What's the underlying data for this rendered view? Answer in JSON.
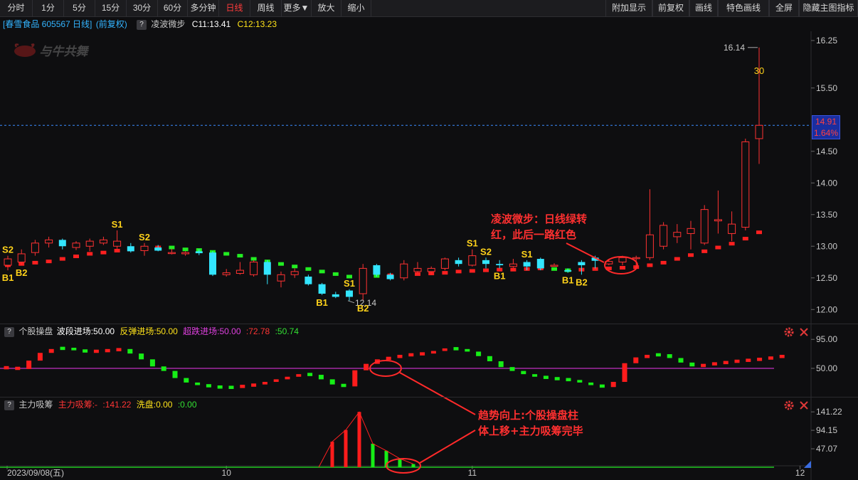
{
  "toolbar": {
    "left": [
      {
        "label": "分时",
        "name": "tab-intraday",
        "w": 46,
        "active": false
      },
      {
        "label": "1分",
        "name": "tab-1min",
        "w": 44,
        "active": false
      },
      {
        "label": "5分",
        "name": "tab-5min",
        "w": 44,
        "active": false
      },
      {
        "label": "15分",
        "name": "tab-15min",
        "w": 44,
        "active": false
      },
      {
        "label": "30分",
        "name": "tab-30min",
        "w": 44,
        "active": false
      },
      {
        "label": "60分",
        "name": "tab-60min",
        "w": 42,
        "active": false
      },
      {
        "label": "多分钟",
        "name": "tab-multi-minute",
        "w": 44,
        "active": false
      },
      {
        "label": "日线",
        "name": "tab-daily",
        "w": 44,
        "active": true
      },
      {
        "label": "周线",
        "name": "tab-weekly",
        "w": 44,
        "active": false
      },
      {
        "label": "更多▼",
        "name": "tab-more",
        "w": 42,
        "active": false
      },
      {
        "label": "放大",
        "name": "zoom-in-button",
        "w": 42,
        "active": false
      },
      {
        "label": "缩小",
        "name": "zoom-out-button",
        "w": 42,
        "active": false
      }
    ],
    "right": [
      {
        "label": "附加显示",
        "name": "extra-display-button",
        "w": 66
      },
      {
        "label": "前复权",
        "name": "forward-adjust-button",
        "w": 52
      },
      {
        "label": "画线",
        "name": "draw-line-button",
        "w": 40
      },
      {
        "label": "特色画线",
        "name": "feature-draw-button",
        "w": 72
      },
      {
        "label": "全屏",
        "name": "fullscreen-button",
        "w": 42
      },
      {
        "label": "隐藏主图指标",
        "name": "hide-indicators-button",
        "w": 83
      }
    ]
  },
  "info": {
    "stock": "[春雪食品 605567 日线]",
    "adjust": "(前复权)",
    "question": "?",
    "indicator": "凌波微步",
    "c1": "C11:13.41",
    "c2": "C12:13.23"
  },
  "logo": "与牛共舞",
  "main_chart": {
    "y_ticks": [
      "16.25",
      "15.50",
      "14.50",
      "14.00",
      "13.50",
      "13.00",
      "12.50",
      "12.00"
    ],
    "current_price": "14.91",
    "change_pct": "1.64%",
    "high_label": "16.14",
    "low_label": "12.14",
    "limit_label": "30",
    "colors": {
      "up": "#ff3232",
      "down": "#33e5ff",
      "line_up": "#ff2020",
      "line_down": "#22ee22",
      "signal": "#ffd21a",
      "price_line": "#3a8cff"
    },
    "signals": [
      {
        "text": "S2",
        "ix": 0,
        "pos": "above"
      },
      {
        "text": "B1",
        "ix": 0,
        "pos": "below"
      },
      {
        "text": "B2",
        "ix": 1,
        "pos": "below"
      },
      {
        "text": "S1",
        "ix": 8,
        "pos": "above"
      },
      {
        "text": "S2",
        "ix": 10,
        "pos": "above"
      },
      {
        "text": "B1",
        "ix": 23,
        "pos": "below"
      },
      {
        "text": "S1",
        "ix": 25,
        "pos": "above"
      },
      {
        "text": "B2",
        "ix": 26,
        "pos": "below"
      },
      {
        "text": "S1",
        "ix": 34,
        "pos": "above"
      },
      {
        "text": "S2",
        "ix": 35,
        "pos": "above"
      },
      {
        "text": "B1",
        "ix": 36,
        "pos": "below"
      },
      {
        "text": "S1",
        "ix": 38,
        "pos": "above"
      },
      {
        "text": "B1",
        "ix": 41,
        "pos": "below"
      },
      {
        "text": "B2",
        "ix": 42,
        "pos": "below"
      }
    ]
  },
  "chart_data": {
    "type": "candlestick",
    "ylim": [
      11.95,
      16.35
    ],
    "candles": [
      [
        12.7,
        12.8,
        12.62,
        12.85
      ],
      [
        12.75,
        12.88,
        12.7,
        12.95
      ],
      [
        12.9,
        13.05,
        12.85,
        13.1
      ],
      [
        13.05,
        13.1,
        12.98,
        13.15
      ],
      [
        13.1,
        13.0,
        12.95,
        13.12
      ],
      [
        12.98,
        13.05,
        12.94,
        13.08
      ],
      [
        13.0,
        13.08,
        12.92,
        13.12
      ],
      [
        13.05,
        13.1,
        13.02,
        13.15
      ],
      [
        13.0,
        13.08,
        12.96,
        13.25
      ],
      [
        13.0,
        12.92,
        12.9,
        13.05
      ],
      [
        12.93,
        13.0,
        12.85,
        13.05
      ],
      [
        12.98,
        12.93,
        12.92,
        13.02
      ],
      [
        12.9,
        12.9,
        12.87,
        12.96
      ],
      [
        12.88,
        12.9,
        12.85,
        12.92
      ],
      [
        12.92,
        12.89,
        12.86,
        12.95
      ],
      [
        12.9,
        12.55,
        12.53,
        12.92
      ],
      [
        12.55,
        12.58,
        12.52,
        12.64
      ],
      [
        12.57,
        12.62,
        12.55,
        12.75
      ],
      [
        12.55,
        12.75,
        12.52,
        12.78
      ],
      [
        12.75,
        12.55,
        12.4,
        12.78
      ],
      [
        12.45,
        12.55,
        12.35,
        12.6
      ],
      [
        12.55,
        12.6,
        12.5,
        12.65
      ],
      [
        12.52,
        12.4,
        12.38,
        12.55
      ],
      [
        12.4,
        12.25,
        12.23,
        12.42
      ],
      [
        12.24,
        12.2,
        12.18,
        12.28
      ],
      [
        12.3,
        12.2,
        12.14,
        12.32
      ],
      [
        12.25,
        12.65,
        12.14,
        12.72
      ],
      [
        12.7,
        12.55,
        12.52,
        12.72
      ],
      [
        12.55,
        12.48,
        12.46,
        12.58
      ],
      [
        12.5,
        12.72,
        12.46,
        12.78
      ],
      [
        12.6,
        12.65,
        12.58,
        12.75
      ],
      [
        12.6,
        12.65,
        12.55,
        12.68
      ],
      [
        12.65,
        12.8,
        12.62,
        12.82
      ],
      [
        12.78,
        12.72,
        12.68,
        12.82
      ],
      [
        12.7,
        12.85,
        12.68,
        12.95
      ],
      [
        12.78,
        12.72,
        12.65,
        12.82
      ],
      [
        12.72,
        12.7,
        12.65,
        12.78
      ],
      [
        12.68,
        12.72,
        12.66,
        12.8
      ],
      [
        12.75,
        12.68,
        12.62,
        12.78
      ],
      [
        12.8,
        12.65,
        12.62,
        12.82
      ],
      [
        12.7,
        12.7,
        12.68,
        12.73
      ],
      [
        12.62,
        12.6,
        12.58,
        12.65
      ],
      [
        12.75,
        12.7,
        12.55,
        12.78
      ],
      [
        12.82,
        12.77,
        12.65,
        12.85
      ],
      [
        12.72,
        12.76,
        12.7,
        12.8
      ],
      [
        12.75,
        12.82,
        12.7,
        12.85
      ],
      [
        12.82,
        12.82,
        12.65,
        12.85
      ],
      [
        12.82,
        13.18,
        12.78,
        13.9
      ],
      [
        13.0,
        13.33,
        12.95,
        13.38
      ],
      [
        13.15,
        13.22,
        13.05,
        13.35
      ],
      [
        13.2,
        13.28,
        12.95,
        13.4
      ],
      [
        13.05,
        13.58,
        13.02,
        13.65
      ],
      [
        13.4,
        13.42,
        13.2,
        13.88
      ],
      [
        13.2,
        13.35,
        13.08,
        13.55
      ],
      [
        13.3,
        14.65,
        13.25,
        14.7
      ],
      [
        14.7,
        14.91,
        14.3,
        16.14
      ]
    ],
    "trend_line": [
      12.7,
      12.72,
      12.74,
      12.76,
      12.8,
      12.84,
      12.88,
      12.9,
      12.93,
      12.95,
      12.97,
      12.98,
      12.98,
      12.95,
      12.94,
      12.91,
      12.88,
      12.85,
      12.8,
      12.76,
      12.72,
      12.68,
      12.64,
      12.6,
      12.56,
      12.52,
      12.52,
      12.53,
      12.54,
      12.56,
      12.56,
      12.57,
      12.58,
      12.6,
      12.61,
      12.62,
      12.63,
      12.63,
      12.64,
      12.65,
      12.64,
      12.62,
      12.63,
      12.64,
      12.65,
      12.66,
      12.67,
      12.7,
      12.74,
      12.8,
      12.86,
      12.92,
      12.98,
      13.04,
      13.12,
      13.22
    ],
    "trend_up": [
      true,
      true,
      true,
      true,
      true,
      true,
      true,
      true,
      true,
      true,
      true,
      true,
      false,
      false,
      false,
      false,
      false,
      false,
      false,
      false,
      false,
      false,
      false,
      false,
      false,
      false,
      true,
      false,
      true,
      true,
      true,
      true,
      true,
      true,
      true,
      true,
      true,
      true,
      true,
      true,
      false,
      false,
      true,
      true,
      true,
      true,
      true,
      true,
      true,
      true,
      true,
      true,
      true,
      true,
      true,
      true
    ],
    "x_labels": [
      {
        "text": "2023/09/08(五)",
        "ix": 0
      },
      {
        "text": "10",
        "ix": 16
      },
      {
        "text": "11",
        "ix": 34
      },
      {
        "text": "12",
        "ix": 58
      }
    ]
  },
  "pane_stock": {
    "question": "?",
    "title": "个股操盘",
    "l1": "波段进场:50.00",
    "l2": "反弹进场:50.00",
    "l3": "超跌进场:50.00",
    "l4": ":72.78",
    "l5": ":50.74",
    "y_ticks": [
      "95.00",
      "50.00"
    ],
    "values": [
      51,
      49,
      62,
      74,
      80,
      82,
      78,
      76,
      77,
      78,
      80,
      73,
      64,
      53,
      46,
      35,
      28,
      24,
      22,
      20,
      21,
      23,
      25,
      29,
      33,
      37,
      41,
      40,
      33,
      25,
      22,
      47,
      57,
      64,
      67,
      70,
      72,
      73,
      77,
      81,
      80,
      76,
      69,
      61,
      52,
      46,
      41,
      37,
      35,
      33,
      32,
      28,
      24,
      21,
      29,
      58,
      67,
      70,
      72,
      66,
      59,
      53,
      56,
      58,
      60,
      62,
      63,
      65,
      67,
      70
    ],
    "up": [
      true,
      true,
      true,
      true,
      true,
      false,
      false,
      false,
      true,
      true,
      true,
      false,
      false,
      false,
      false,
      false,
      false,
      false,
      false,
      false,
      false,
      true,
      true,
      true,
      true,
      true,
      true,
      false,
      false,
      false,
      false,
      true,
      true,
      true,
      true,
      true,
      true,
      true,
      true,
      true,
      false,
      false,
      false,
      false,
      false,
      false,
      false,
      false,
      false,
      false,
      false,
      false,
      false,
      false,
      true,
      true,
      true,
      true,
      false,
      false,
      false,
      false,
      true,
      true,
      true,
      true,
      true,
      true,
      true,
      true
    ]
  },
  "pane_main": {
    "question": "?",
    "title": "主力吸筹",
    "l1": "主力吸筹:-",
    "l2": ":141.22",
    "l3": "洗盘:0.00",
    "l4": ":0.00",
    "y_ticks": [
      "141.22",
      "94.15",
      "47.07"
    ],
    "bars": [
      {
        "ix": 24,
        "v": 65,
        "c": "red"
      },
      {
        "ix": 25,
        "v": 95,
        "c": "red"
      },
      {
        "ix": 26,
        "v": 141,
        "c": "red"
      },
      {
        "ix": 27,
        "v": 60,
        "c": "green"
      },
      {
        "ix": 28,
        "v": 42,
        "c": "green"
      },
      {
        "ix": 29,
        "v": 22,
        "c": "green"
      },
      {
        "ix": 30,
        "v": 8,
        "c": "green"
      }
    ]
  },
  "annotations": {
    "a1_l1": "凌波微步：日线绿转",
    "a1_l2": "红，此后一路红色",
    "a2_l1": "趋势向上:个股操盘柱",
    "a2_l2": "体上移+主力吸筹完毕"
  }
}
